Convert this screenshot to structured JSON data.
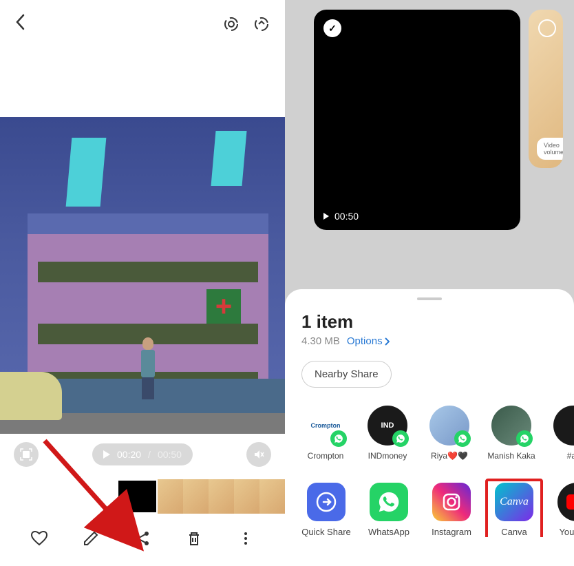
{
  "left": {
    "playback": {
      "current": "00:20",
      "separator": "/",
      "total": "00:50"
    }
  },
  "right": {
    "media": {
      "duration": "00:50",
      "side_label": "Video volume"
    },
    "sheet": {
      "title": "1 item",
      "size": "4.30 MB",
      "options": "Options",
      "nearby": "Nearby Share"
    },
    "contacts": [
      {
        "name": "Crompton",
        "icon_text": "Crompton"
      },
      {
        "name": "INDmoney",
        "icon_text": "IND"
      },
      {
        "name": "Riya❤️🖤"
      },
      {
        "name": "Manish Kaka"
      },
      {
        "name": "#all"
      }
    ],
    "apps": [
      {
        "name": "Quick Share"
      },
      {
        "name": "WhatsApp"
      },
      {
        "name": "Instagram"
      },
      {
        "name": "Canva",
        "highlighted": true,
        "icon_text": "Canva"
      },
      {
        "name": "YouTube"
      }
    ]
  }
}
